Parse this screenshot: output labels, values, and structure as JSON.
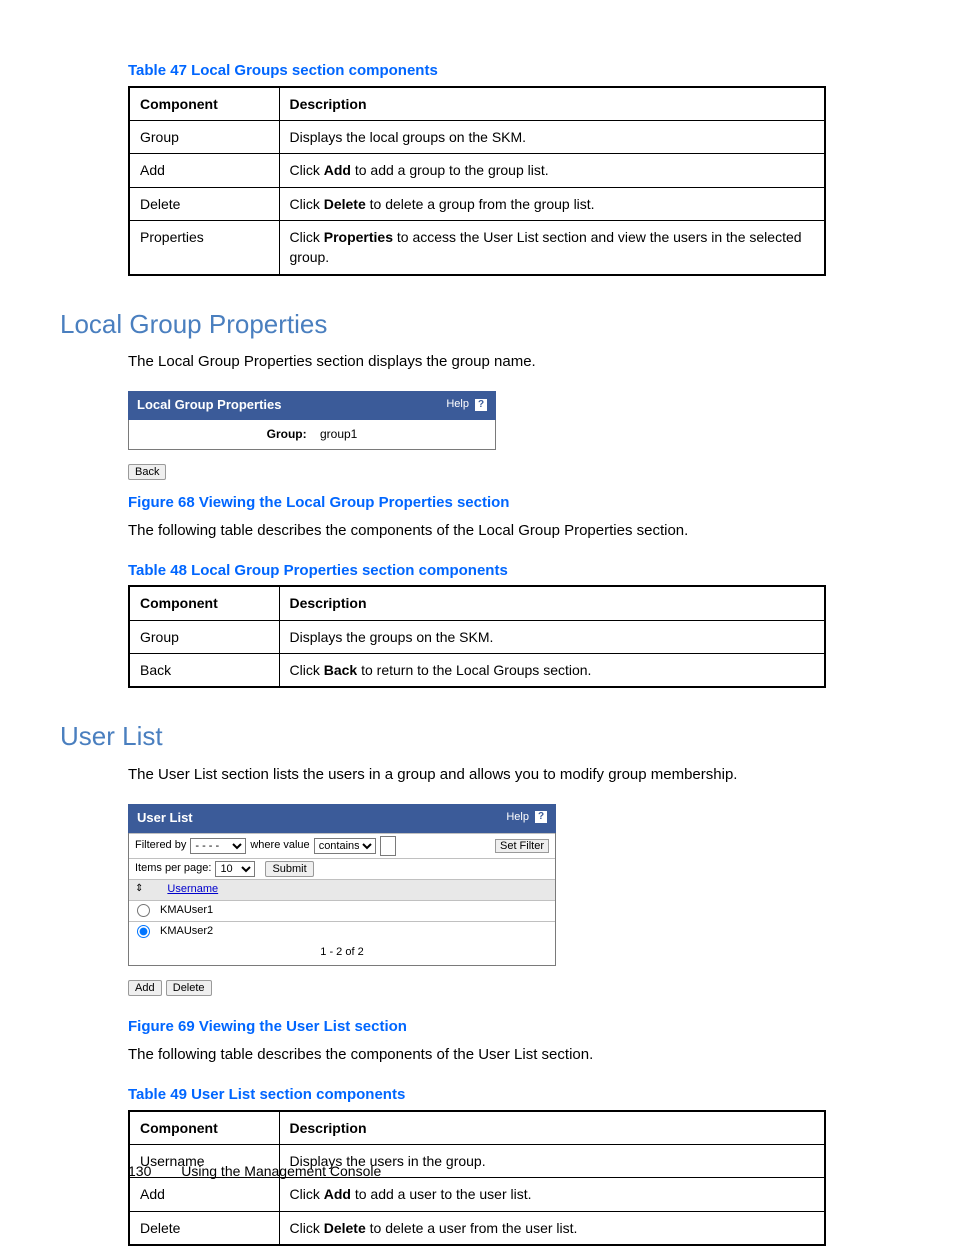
{
  "table47": {
    "caption": "Table 47 Local Groups section components",
    "headers": [
      "Component",
      "Description"
    ],
    "rows": [
      {
        "component": "Group",
        "desc_pre": "Displays the local groups on the SKM.",
        "bold": "",
        "desc_post": ""
      },
      {
        "component": "Add",
        "desc_pre": "Click ",
        "bold": "Add",
        "desc_post": " to add a group to the group list."
      },
      {
        "component": "Delete",
        "desc_pre": "Click ",
        "bold": "Delete",
        "desc_post": " to delete a group from the group list."
      },
      {
        "component": "Properties",
        "desc_pre": "Click ",
        "bold": "Properties",
        "desc_post": " to access the User List section and view the users in the selected group."
      }
    ]
  },
  "section1": {
    "title": "Local Group Properties",
    "intro": "The Local Group Properties section displays the group name."
  },
  "panel1": {
    "title": "Local Group Properties",
    "help": "Help",
    "group_label": "Group:",
    "group_value": "group1",
    "back": "Back"
  },
  "figure68": "Figure 68 Viewing the Local Group Properties section",
  "para68": "The following table describes the components of the Local Group Properties section.",
  "table48": {
    "caption": "Table 48 Local Group Properties section components",
    "headers": [
      "Component",
      "Description"
    ],
    "rows": [
      {
        "component": "Group",
        "desc_pre": "Displays the groups on the SKM.",
        "bold": "",
        "desc_post": ""
      },
      {
        "component": "Back",
        "desc_pre": "Click ",
        "bold": "Back",
        "desc_post": " to return to the Local Groups section."
      }
    ]
  },
  "section2": {
    "title": "User List",
    "intro": "The User List section lists the users in a group and allows you to modify group membership."
  },
  "panel2": {
    "title": "User List",
    "help": "Help",
    "filtered_by": "Filtered by",
    "filter_field_placeholder": "- - - -",
    "where_value": "where value",
    "contains": "contains",
    "set_filter": "Set Filter",
    "items_per_page": "Items per page:",
    "ipp_value": "10",
    "submit": "Submit",
    "col_username": "Username",
    "rows": [
      {
        "name": "KMAUser1",
        "selected": false
      },
      {
        "name": "KMAUser2",
        "selected": true
      }
    ],
    "pager": "1 - 2 of 2",
    "add": "Add",
    "delete": "Delete"
  },
  "figure69": "Figure 69 Viewing the User List section",
  "para69": "The following table describes the components of the User List section.",
  "table49": {
    "caption": "Table 49 User List section components",
    "headers": [
      "Component",
      "Description"
    ],
    "rows": [
      {
        "component": "Username",
        "desc_pre": "Displays the users in the group.",
        "bold": "",
        "desc_post": ""
      },
      {
        "component": "Add",
        "desc_pre": "Click ",
        "bold": "Add",
        "desc_post": " to add a user to the user list."
      },
      {
        "component": "Delete",
        "desc_pre": "Click ",
        "bold": "Delete",
        "desc_post": " to delete a user from the user list."
      }
    ]
  },
  "footer": {
    "page": "130",
    "title": "Using the Management Console"
  }
}
